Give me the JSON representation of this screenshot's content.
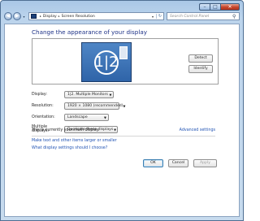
{
  "window": {
    "minimize_glyph": "–",
    "maximize_glyph": "□",
    "close_glyph": "✕"
  },
  "nav": {
    "back_glyph": "◀",
    "forward_glyph": "▶",
    "breadcrumb": [
      "Display",
      "Screen Resolution"
    ],
    "separator": "▸",
    "search_placeholder": "Search Control Panel"
  },
  "page": {
    "title": "Change the appearance of your display",
    "monitor_label": "1|2",
    "detect_label": "Detect",
    "identify_label": "Identify"
  },
  "settings": {
    "display": {
      "label": "Display:",
      "value": "1|2. Multiple Monitors"
    },
    "resolution": {
      "label": "Resolution:",
      "value": "1920 × 1080 (recommended)"
    },
    "orientation": {
      "label": "Orientation:",
      "value": "Landscape"
    },
    "multiple": {
      "label": "Multiple displays:",
      "value": "Duplicate these displays"
    }
  },
  "status": {
    "main_display": "This is currently your main display.",
    "advanced": "Advanced settings"
  },
  "links": {
    "text_size": "Make text and other items larger or smaller",
    "which_settings": "What display settings should I choose?"
  },
  "buttons": {
    "ok": "OK",
    "cancel": "Cancel",
    "apply": "Apply"
  },
  "colors": {
    "title_blue": "#1e3287",
    "link_blue": "#1f52b3",
    "monitor_blue": "#3a73b8"
  }
}
